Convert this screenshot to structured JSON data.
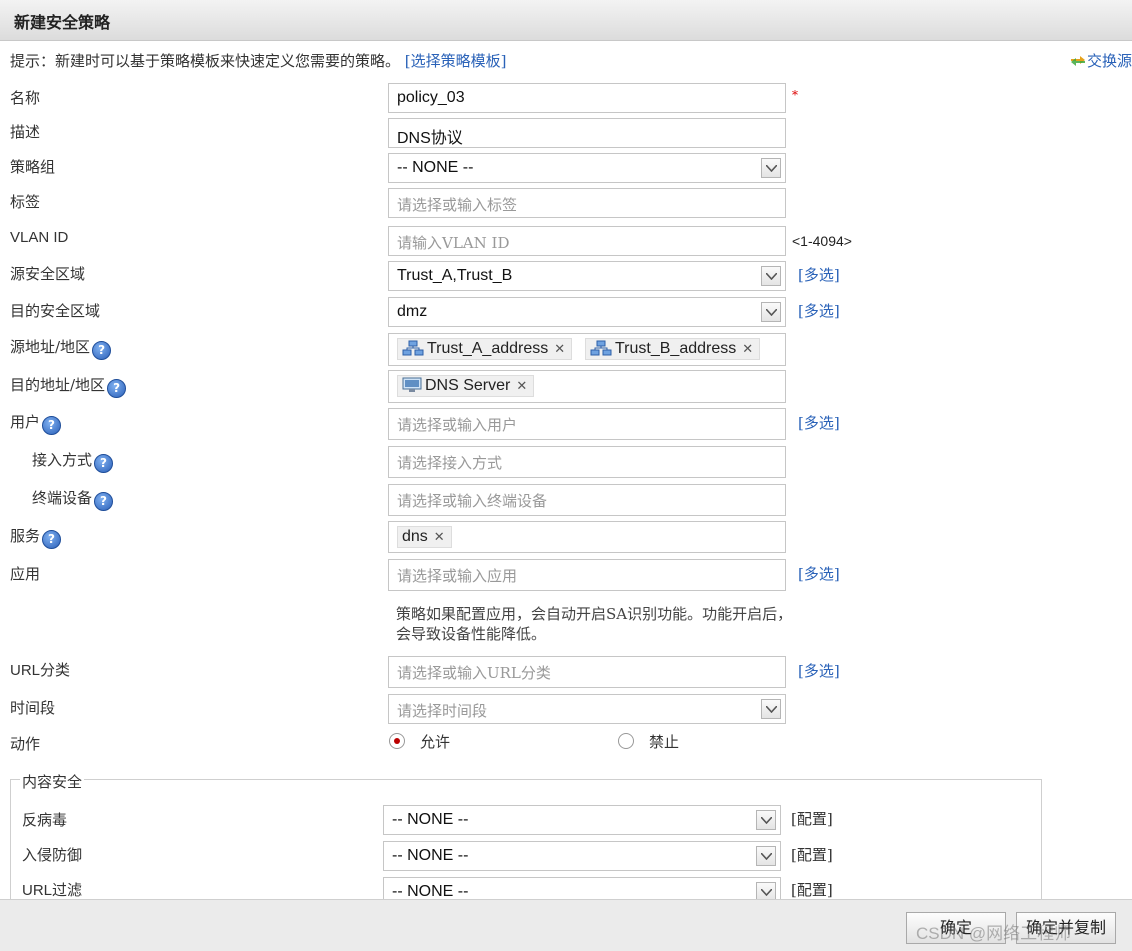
{
  "window": {
    "title": "新建安全策略"
  },
  "hint": {
    "text": "提示：新建时可以基于策略模板来快速定义您需要的策略。",
    "link": "[选择策略模板]"
  },
  "swap": {
    "label": "交换源"
  },
  "form": {
    "name": {
      "label": "名称",
      "value": "policy_03",
      "required_mark": "*"
    },
    "description": {
      "label": "描述",
      "value": "DNS协议"
    },
    "policy_group": {
      "label": "策略组",
      "value": "-- NONE --"
    },
    "tag": {
      "label": "标签",
      "placeholder": "请选择或输入标签"
    },
    "vlan": {
      "label": "VLAN ID",
      "placeholder": "请输入VLAN ID",
      "range": "<1-4094>"
    },
    "src_zone": {
      "label": "源安全区域",
      "value": "Trust_A,Trust_B",
      "multi": "[多选]"
    },
    "dst_zone": {
      "label": "目的安全区域",
      "value": "dmz",
      "multi": "[多选]"
    },
    "src_addr": {
      "label": "源地址/地区",
      "tags": [
        "Trust_A_address",
        "Trust_B_address"
      ]
    },
    "dst_addr": {
      "label": "目的地址/地区",
      "tags": [
        "DNS Server"
      ]
    },
    "user": {
      "label": "用户",
      "placeholder": "请选择或输入用户",
      "multi": "[多选]"
    },
    "access": {
      "label": "接入方式",
      "placeholder": "请选择接入方式"
    },
    "terminal": {
      "label": "终端设备",
      "placeholder": "请选择或输入终端设备"
    },
    "service": {
      "label": "服务",
      "tags": [
        "dns"
      ]
    },
    "application": {
      "label": "应用",
      "placeholder": "请选择或输入应用",
      "multi": "[多选]",
      "note": "策略如果配置应用，会自动开启SA识别功能。功能开启后，会导致设备性能降低。"
    },
    "url_category": {
      "label": "URL分类",
      "placeholder": "请选择或输入URL分类",
      "multi": "[多选]"
    },
    "time_range": {
      "label": "时间段",
      "placeholder": "请选择时间段"
    },
    "action": {
      "label": "动作",
      "options": [
        "允许",
        "禁止"
      ],
      "selected": "允许"
    }
  },
  "content_security": {
    "legend": "内容安全",
    "rows": [
      {
        "label": "反病毒",
        "value": "-- NONE --",
        "config": "[配置]"
      },
      {
        "label": "入侵防御",
        "value": "-- NONE --",
        "config": "[配置]"
      },
      {
        "label": "URL过滤",
        "value": "-- NONE --",
        "config": "[配置]"
      }
    ]
  },
  "footer": {
    "ok": "确定",
    "ok_copy": "确定并复制"
  },
  "watermark": "CSDN @网络工程师"
}
